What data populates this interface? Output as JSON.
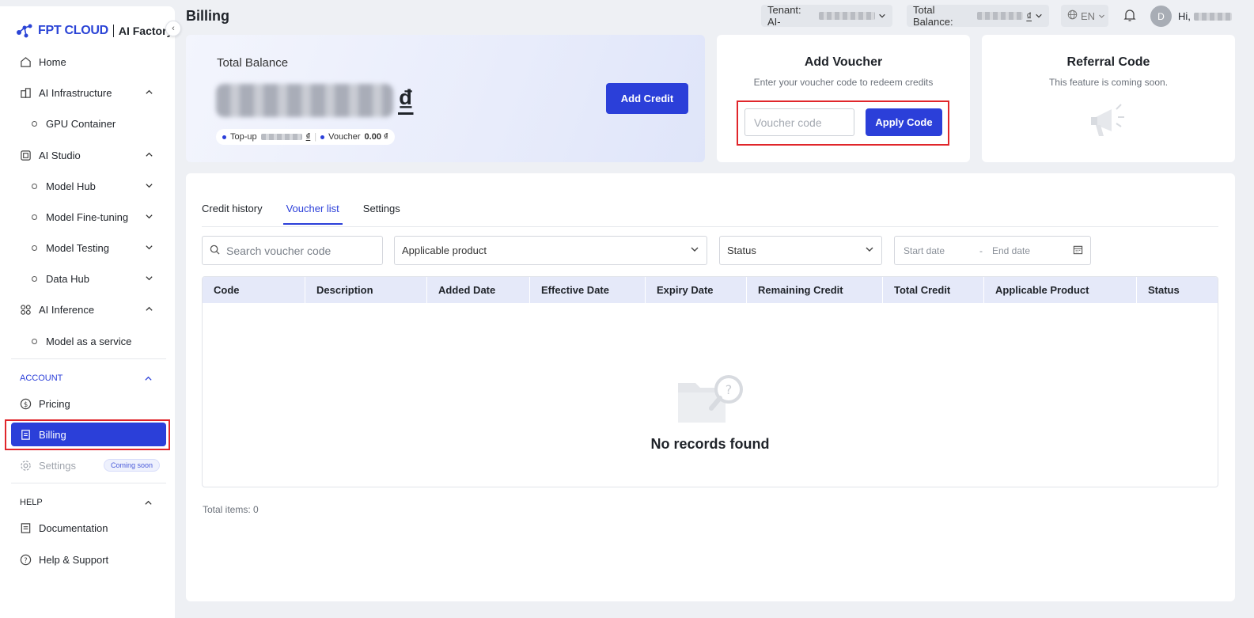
{
  "app": {
    "brand": "FPT CLOUD",
    "product": "AI Factory"
  },
  "sidebar": {
    "items": [
      {
        "label": "Home"
      },
      {
        "label": "AI Infrastructure"
      },
      {
        "label": "GPU Container"
      },
      {
        "label": "AI Studio"
      },
      {
        "label": "Model Hub"
      },
      {
        "label": "Model Fine-tuning"
      },
      {
        "label": "Model Testing"
      },
      {
        "label": "Data Hub"
      },
      {
        "label": "AI Inference"
      },
      {
        "label": "Model as a service"
      }
    ],
    "account_section": "ACCOUNT",
    "account_items": [
      {
        "label": "Pricing"
      },
      {
        "label": "Billing"
      },
      {
        "label": "Settings",
        "badge": "Coming soon"
      }
    ],
    "help_section": "HELP",
    "help_items": [
      {
        "label": "Documentation"
      },
      {
        "label": "Help & Support"
      }
    ]
  },
  "header": {
    "title": "Billing",
    "tenant_label": "Tenant: AI-",
    "balance_label": "Total Balance:",
    "currency_symbol": "₫",
    "language": "EN",
    "avatar_initial": "D",
    "greeting": "Hi,"
  },
  "balance_card": {
    "title": "Total Balance",
    "currency_symbol": "₫",
    "topup_label": "Top-up",
    "voucher_label": "Voucher",
    "voucher_value": "0.00 ₫",
    "add_credit": "Add Credit"
  },
  "voucher_card": {
    "title": "Add Voucher",
    "subtitle": "Enter your voucher code to redeem credits",
    "input_placeholder": "Voucher code",
    "apply_button": "Apply Code"
  },
  "referral_card": {
    "title": "Referral Code",
    "subtitle": "This feature is coming soon."
  },
  "tabs": [
    {
      "label": "Credit history"
    },
    {
      "label": "Voucher list"
    },
    {
      "label": "Settings"
    }
  ],
  "filters": {
    "search_placeholder": "Search voucher code",
    "product": "Applicable product",
    "status": "Status",
    "start_date": "Start date",
    "date_sep": "-",
    "end_date": "End date"
  },
  "table": {
    "columns": [
      "Code",
      "Description",
      "Added Date",
      "Effective Date",
      "Expiry Date",
      "Remaining Credit",
      "Total Credit",
      "Applicable Product",
      "Status"
    ],
    "empty_text": "No records found"
  },
  "total_items": "Total items: 0",
  "colors": {
    "accent": "#2b3fd9",
    "highlight": "#e0262b"
  }
}
